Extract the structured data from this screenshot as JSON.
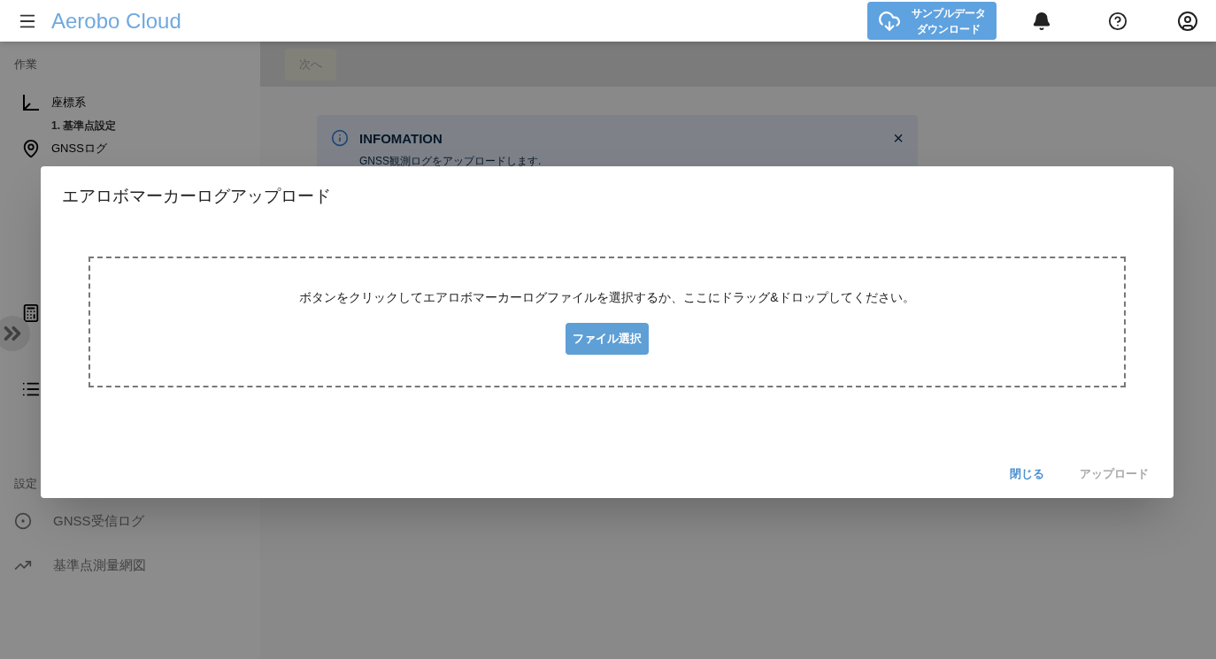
{
  "header": {
    "title": "Aerobo Cloud",
    "sample_button": [
      "サンプルデータ",
      "ダウンロード"
    ]
  },
  "sidebar": {
    "sections": [
      {
        "heading": "作業",
        "items": [
          {
            "label": "座標系",
            "disabled": false,
            "children": [
              {
                "label": "1. 基準点設定",
                "disabled": false
              }
            ]
          },
          {
            "label": "GNSSログ",
            "disabled": false
          },
          {
            "disabled": false
          },
          {
            "disabled": false
          }
        ]
      },
      {
        "heading": "設定",
        "items": [
          {
            "label": "GNSS受信ログ",
            "disabled": true
          },
          {
            "label": "基準点測量網図",
            "disabled": true
          }
        ]
      }
    ]
  },
  "toolbar": {
    "next_button": {
      "label": "次へ",
      "disabled": true
    }
  },
  "alert": {
    "title": "INFOMATION",
    "message": "GNSS観測ログをアップロードします.",
    "close": "×"
  },
  "dialog": {
    "title": "エアロボマーカーログアップロード",
    "drop_text": "ボタンをクリックしてエアロボマーカーログファイルを選択するか、ここにドラッグ&ドロップしてください。",
    "select_button": "ファイル選択",
    "actions": [
      {
        "label": "閉じる",
        "disabled": false
      },
      {
        "label": "アップロード",
        "disabled": true
      }
    ]
  }
}
